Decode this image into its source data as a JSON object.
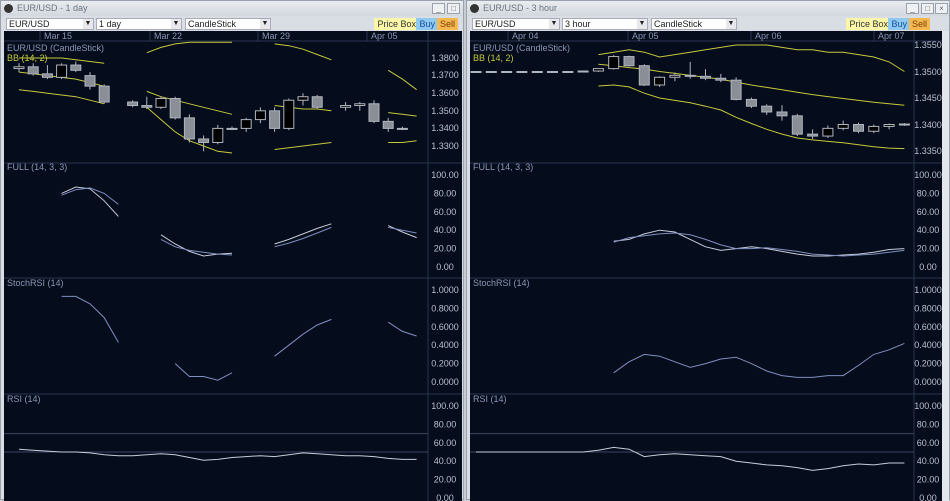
{
  "windows": [
    {
      "title": "EUR/USD - 1 day",
      "symbol": "EUR/USD",
      "interval": "1 day",
      "chart_type": "CandleStick",
      "buttons": {
        "price_box": "Price Box",
        "buy": "Buy",
        "sell": "Sell"
      },
      "dates": [
        "Mar 15",
        "Mar 22",
        "Mar 29",
        "Apr 05"
      ],
      "price_label": "EUR/USD (CandleStick)",
      "bb_label": "BB (14, 2)",
      "price_ticks": [
        "1.3800",
        "1.3700",
        "1.3600",
        "1.3500",
        "1.3400",
        "1.3300"
      ],
      "full_label": "FULL (14, 3, 3)",
      "stoch_label": "StochRSI (14)",
      "rsi_label": "RSI (14)",
      "osc_ticks": [
        "100.00",
        "80.00",
        "60.00",
        "40.00",
        "20.00",
        "0.00"
      ],
      "stoch_ticks": [
        "1.0000",
        "0.8000",
        "0.6000",
        "0.4000",
        "0.2000",
        "0.0000"
      ],
      "price_range": [
        1.33,
        1.38
      ],
      "candles": [
        [
          1.374,
          1.377,
          1.372,
          1.375
        ],
        [
          1.375,
          1.377,
          1.37,
          1.371
        ],
        [
          1.371,
          1.376,
          1.368,
          1.369
        ],
        [
          1.369,
          1.377,
          1.368,
          1.376
        ],
        [
          1.376,
          1.378,
          1.372,
          1.373
        ],
        [
          1.37,
          1.372,
          1.362,
          1.364
        ],
        [
          1.364,
          1.365,
          1.354,
          1.355
        ],
        null,
        [
          1.355,
          1.356,
          1.352,
          1.353
        ],
        [
          1.353,
          1.358,
          1.351,
          1.352
        ],
        [
          1.352,
          1.358,
          1.351,
          1.357
        ],
        [
          1.357,
          1.358,
          1.345,
          1.346
        ],
        [
          1.346,
          1.348,
          1.332,
          1.334
        ],
        [
          1.334,
          1.336,
          1.327,
          1.332
        ],
        [
          1.332,
          1.342,
          1.331,
          1.34
        ],
        [
          1.34,
          1.341,
          1.339,
          1.34
        ],
        [
          1.34,
          1.346,
          1.338,
          1.345
        ],
        [
          1.345,
          1.352,
          1.343,
          1.35
        ],
        [
          1.35,
          1.352,
          1.338,
          1.34
        ],
        [
          1.34,
          1.357,
          1.339,
          1.356
        ],
        [
          1.356,
          1.36,
          1.353,
          1.358
        ],
        [
          1.358,
          1.359,
          1.351,
          1.352
        ],
        null,
        [
          1.352,
          1.355,
          1.35,
          1.353
        ],
        [
          1.353,
          1.355,
          1.35,
          1.354
        ],
        [
          1.354,
          1.356,
          1.343,
          1.344
        ],
        [
          1.344,
          1.346,
          1.338,
          1.34
        ],
        [
          1.34,
          1.341,
          1.339,
          1.34
        ]
      ],
      "bb_upper": [
        1.38,
        1.38,
        1.38,
        1.38,
        1.379,
        1.378,
        1.377,
        null,
        null,
        1.383,
        1.386,
        1.388,
        1.389,
        1.389,
        1.389,
        1.389,
        null,
        null,
        1.388,
        1.387,
        1.385,
        1.382,
        1.379,
        null,
        null,
        null,
        1.373,
        1.368,
        1.362
      ],
      "bb_mid": [
        1.372,
        1.371,
        1.37,
        1.369,
        1.368,
        1.366,
        1.364,
        null,
        null,
        1.361,
        1.358,
        1.356,
        1.354,
        1.352,
        1.35,
        1.348,
        null,
        null,
        1.353,
        1.352,
        1.351,
        1.351,
        1.35,
        null,
        null,
        null,
        1.349,
        1.348,
        1.347
      ],
      "bb_lower": [
        1.362,
        1.361,
        1.36,
        1.359,
        1.358,
        1.356,
        1.354,
        null,
        null,
        1.352,
        1.345,
        1.338,
        1.333,
        1.33,
        1.327,
        1.326,
        null,
        null,
        1.328,
        1.329,
        1.33,
        1.331,
        1.332,
        null,
        null,
        null,
        1.332,
        1.332,
        1.333
      ],
      "full_k": [
        null,
        null,
        null,
        80,
        87,
        85,
        72,
        55,
        null,
        null,
        35,
        25,
        17,
        12,
        14,
        15,
        null,
        null,
        25,
        30,
        36,
        42,
        47,
        null,
        null,
        null,
        45,
        38,
        32
      ],
      "full_d": [
        null,
        null,
        null,
        78,
        84,
        86,
        80,
        68,
        null,
        null,
        30,
        22,
        18,
        16,
        14,
        13,
        null,
        null,
        22,
        26,
        31,
        37,
        43,
        null,
        null,
        null,
        43,
        40,
        37
      ],
      "stochrsi": [
        null,
        null,
        null,
        0.93,
        0.93,
        0.85,
        0.7,
        0.43,
        null,
        null,
        null,
        0.2,
        0.06,
        0.06,
        0.02,
        0.1,
        null,
        null,
        0.28,
        0.4,
        0.52,
        0.62,
        0.68,
        null,
        null,
        null,
        0.65,
        0.55,
        0.5
      ],
      "rsi": [
        53,
        52,
        51,
        50,
        50,
        49,
        47,
        46,
        46,
        47,
        48,
        47,
        44,
        41,
        42,
        44,
        45,
        46,
        45,
        47,
        49,
        48,
        47,
        46,
        46,
        45,
        43,
        42,
        42
      ],
      "rsi_levels": [
        70,
        50
      ]
    },
    {
      "title": "EUR/USD - 3 hour",
      "symbol": "EUR/USD",
      "interval": "3 hour",
      "chart_type": "CandleStick",
      "buttons": {
        "price_box": "Price Box",
        "buy": "Buy",
        "sell": "Sell"
      },
      "dates": [
        "Apr 04",
        "Apr 05",
        "Apr 06",
        "Apr 07"
      ],
      "price_label": "EUR/USD (CandleStick)",
      "bb_label": "BB (14, 2)",
      "price_ticks": [
        "1.3550",
        "1.3500",
        "1.3450",
        "1.3400",
        "1.3350"
      ],
      "full_label": "FULL (14, 3, 3)",
      "stoch_label": "StochRSI (14)",
      "rsi_label": "RSI (14)",
      "osc_ticks": [
        "100.00",
        "80.00",
        "60.00",
        "40.00",
        "20.00",
        "0.00"
      ],
      "stoch_ticks": [
        "1.0000",
        "0.8000",
        "0.6000",
        "0.4000",
        "0.2000",
        "0.0000"
      ],
      "price_range": [
        1.3335,
        1.3555
      ],
      "candles": [
        [
          1.35,
          1.35,
          1.35,
          1.35
        ],
        [
          1.35,
          1.35,
          1.35,
          1.35
        ],
        [
          1.35,
          1.35,
          1.35,
          1.35
        ],
        [
          1.35,
          1.35,
          1.35,
          1.35
        ],
        [
          1.35,
          1.35,
          1.35,
          1.35
        ],
        [
          1.35,
          1.35,
          1.35,
          1.35
        ],
        [
          1.35,
          1.35,
          1.35,
          1.35
        ],
        [
          1.35,
          1.3502,
          1.3498,
          1.3501
        ],
        [
          1.3501,
          1.3506,
          1.3499,
          1.3506
        ],
        [
          1.3506,
          1.3534,
          1.3504,
          1.3531
        ],
        [
          1.3531,
          1.3533,
          1.351,
          1.3512
        ],
        [
          1.3512,
          1.3515,
          1.347,
          1.3472
        ],
        [
          1.3472,
          1.349,
          1.3468,
          1.3488
        ],
        [
          1.3488,
          1.3498,
          1.348,
          1.3492
        ],
        [
          1.3492,
          1.352,
          1.3485,
          1.349
        ],
        [
          1.349,
          1.3505,
          1.3482,
          1.3486
        ],
        [
          1.3486,
          1.3495,
          1.3478,
          1.3482
        ],
        [
          1.3482,
          1.3488,
          1.344,
          1.3442
        ],
        [
          1.3442,
          1.3446,
          1.3424,
          1.3428
        ],
        [
          1.3428,
          1.3432,
          1.341,
          1.3416
        ],
        [
          1.3416,
          1.343,
          1.3398,
          1.3408
        ],
        [
          1.3408,
          1.3412,
          1.3366,
          1.337
        ],
        [
          1.337,
          1.338,
          1.336,
          1.3366
        ],
        [
          1.3366,
          1.3388,
          1.3362,
          1.3382
        ],
        [
          1.3382,
          1.3398,
          1.3378,
          1.339
        ],
        [
          1.339,
          1.3394,
          1.3372,
          1.3376
        ],
        [
          1.3376,
          1.339,
          1.3372,
          1.3386
        ],
        [
          1.3386,
          1.3392,
          1.338,
          1.339
        ],
        [
          1.339,
          1.3393,
          1.3387,
          1.3391
        ]
      ],
      "bb_upper": [
        null,
        null,
        null,
        null,
        null,
        null,
        null,
        null,
        1.3535,
        1.354,
        1.3545,
        1.354,
        1.353,
        1.3535,
        1.354,
        1.3545,
        1.355,
        1.3555,
        1.3555,
        1.3555,
        1.355,
        1.3545,
        1.3545,
        1.354,
        1.354,
        1.3535,
        1.353,
        1.352,
        1.35
      ],
      "bb_mid": [
        null,
        null,
        null,
        null,
        null,
        null,
        null,
        null,
        1.3515,
        1.3512,
        1.3508,
        1.3505,
        1.35,
        1.3496,
        1.3492,
        1.3488,
        1.3484,
        1.3478,
        1.3472,
        1.3467,
        1.3462,
        1.3457,
        1.3452,
        1.3448,
        1.3444,
        1.344,
        1.3436,
        1.3433,
        1.343
      ],
      "bb_lower": [
        null,
        null,
        null,
        null,
        null,
        null,
        null,
        null,
        1.347,
        1.3472,
        1.3468,
        1.3455,
        1.3445,
        1.344,
        1.3435,
        1.3428,
        1.342,
        1.3405,
        1.3392,
        1.338,
        1.337,
        1.3362,
        1.3358,
        1.3355,
        1.3352,
        1.3348,
        1.3344,
        1.3341,
        1.334
      ],
      "full_k": [
        null,
        null,
        null,
        null,
        null,
        null,
        null,
        null,
        null,
        28,
        30,
        36,
        40,
        38,
        30,
        22,
        18,
        20,
        22,
        20,
        17,
        14,
        12,
        12,
        13,
        14,
        16,
        19,
        20
      ],
      "full_d": [
        null,
        null,
        null,
        null,
        null,
        null,
        null,
        null,
        null,
        27,
        32,
        34,
        36,
        37,
        35,
        30,
        24,
        20,
        20,
        21,
        19,
        17,
        14,
        13,
        12,
        13,
        14,
        16,
        18
      ],
      "stochrsi": [
        null,
        null,
        null,
        null,
        null,
        null,
        null,
        null,
        null,
        0.1,
        0.22,
        0.3,
        0.28,
        0.22,
        0.16,
        0.2,
        0.25,
        0.27,
        0.2,
        0.12,
        0.07,
        0.05,
        0.05,
        0.07,
        0.07,
        0.18,
        0.3,
        0.35,
        0.42
      ],
      "rsi": [
        50,
        50,
        50,
        50,
        50,
        50,
        50,
        50,
        52,
        55,
        53,
        45,
        47,
        48,
        47,
        46,
        45,
        40,
        38,
        36,
        35,
        33,
        30,
        32,
        35,
        37,
        36,
        38,
        38
      ],
      "rsi_levels": [
        70,
        50
      ]
    }
  ],
  "colors": {
    "bg": "#050c1c",
    "bb": "#c8c83c",
    "line": "#c8ccd8",
    "line2": "#7f8fbf",
    "label": "#8a96b4",
    "grid": "#2a3450"
  }
}
